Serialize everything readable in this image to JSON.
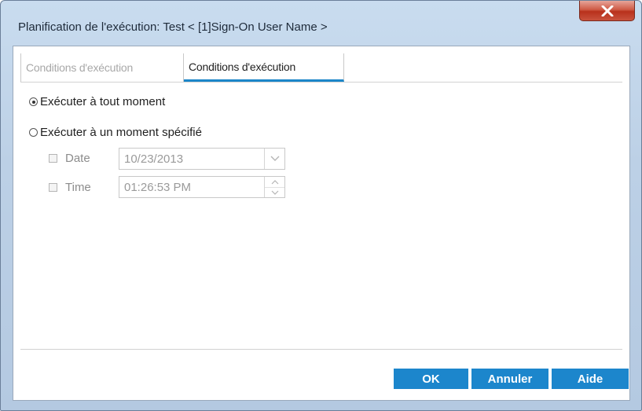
{
  "window": {
    "title": "Planification de l'exécution: Test < [1]Sign-On User Name >",
    "close_icon": "close-x-icon"
  },
  "tabs": [
    {
      "label": "Conditions d'exécution",
      "active": false
    },
    {
      "label": "Conditions d'exécution",
      "active": true
    }
  ],
  "options": {
    "any_time": {
      "label": "Exécuter à tout moment",
      "selected": true
    },
    "specified_time": {
      "label": "Exécuter à un moment spécifié",
      "selected": false
    }
  },
  "date": {
    "label": "Date",
    "checked": false,
    "value": "10/23/2013",
    "icon": "chevron-down-icon"
  },
  "time": {
    "label": "Time",
    "checked": false,
    "value": "01:26:53 PM",
    "icon_up": "spin-up-icon",
    "icon_down": "spin-down-icon"
  },
  "buttons": {
    "ok": "OK",
    "cancel": "Annuler",
    "help": "Aide"
  },
  "colors": {
    "accent": "#1c86cc",
    "close": "#c9533d",
    "frame": "#bcd0e6"
  }
}
